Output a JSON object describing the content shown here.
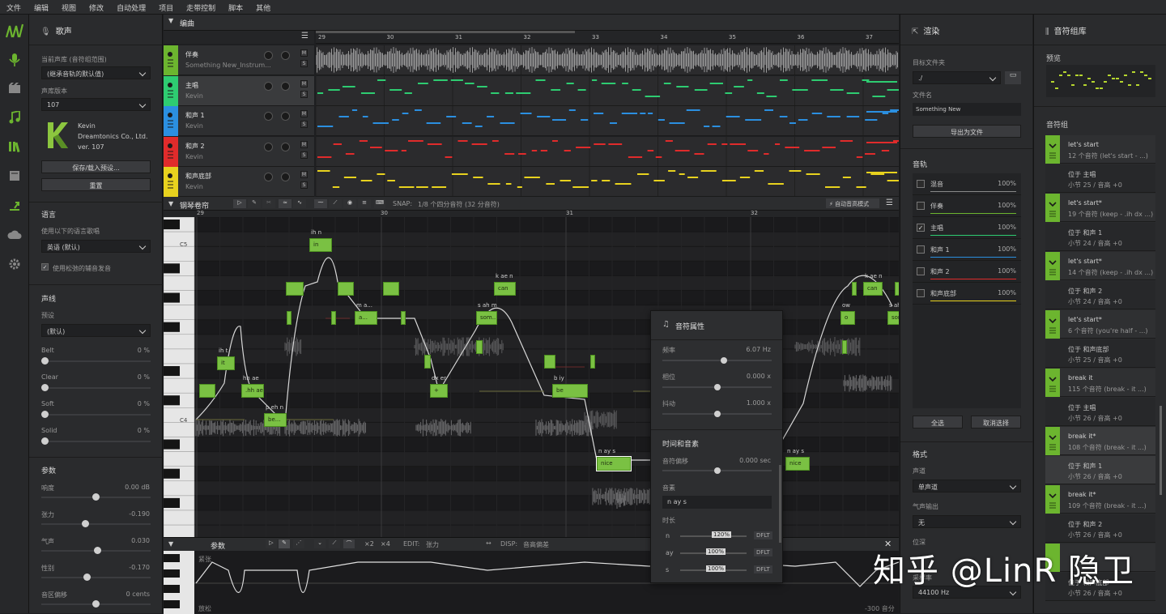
{
  "menu": [
    "文件",
    "编辑",
    "视图",
    "修改",
    "自动处理",
    "项目",
    "走带控制",
    "脚本",
    "其他"
  ],
  "voice": {
    "title": "歌声",
    "db_label": "当前声库 (音符组范围)",
    "db_value": "(继承音轨的默认值)",
    "version_label": "声库版本",
    "version_value": "107",
    "singer_name": "Kevin",
    "singer_company": "Dreamtonics Co., Ltd.",
    "singer_ver": "ver. 107",
    "save_btn": "保存/载入预设...",
    "reset_btn": "重置",
    "lang_header": "语言",
    "lang_label": "使用以下的语言歌唱",
    "lang_value": "英语 (默认)",
    "lang_check": "使用松弛的辅音发音",
    "timbre_header": "声线",
    "preset_label": "预设",
    "preset_value": "(默认)",
    "timbres": [
      {
        "name": "Belt",
        "val": "0 %"
      },
      {
        "name": "Clear",
        "val": "0 %"
      },
      {
        "name": "Soft",
        "val": "0 %"
      },
      {
        "name": "Solid",
        "val": "0 %"
      }
    ],
    "params_header": "参数",
    "params": [
      {
        "name": "响度",
        "val": "0.00 dB"
      },
      {
        "name": "张力",
        "val": "-0.190"
      },
      {
        "name": "气声",
        "val": "0.030"
      },
      {
        "name": "性别",
        "val": "-0.170"
      },
      {
        "name": "音区偏移",
        "val": "0 cents"
      }
    ]
  },
  "arrange": {
    "title": "编曲",
    "measures": [
      "29",
      "30",
      "31",
      "32",
      "33",
      "34",
      "35",
      "36",
      "37"
    ],
    "tracks": [
      {
        "name": "伴奏",
        "sub": "Something New_Instrum...",
        "color": "#6cb52f",
        "icon": "headphones-icon"
      },
      {
        "name": "主唱",
        "sub": "Kevin",
        "color": "#2ecc71",
        "icon": "singer-icon"
      },
      {
        "name": "和声 1",
        "sub": "Kevin",
        "color": "#2b8fe0",
        "icon": "singer-icon"
      },
      {
        "name": "和声 2",
        "sub": "Kevin",
        "color": "#e02b2b",
        "icon": "singer-icon"
      },
      {
        "name": "和声底部",
        "sub": "Kevin",
        "color": "#e8d21e",
        "icon": "singer-icon"
      }
    ],
    "m_label": "M",
    "s_label": "S"
  },
  "pianoroll": {
    "title": "钢琴卷帘",
    "snap_label": "SNAP:",
    "snap_value": "1/8 个四分音符 (32 分音符)",
    "auto_pitch": "自动音高模式",
    "measures": [
      "29",
      "30",
      "31",
      "32"
    ],
    "c5": "C5",
    "c4": "C4",
    "c3": "C3"
  },
  "params_bar": {
    "title": "参数",
    "edit_label": "EDIT:",
    "edit_value": "张力",
    "disp_label": "DISP:",
    "disp_value": "音高偏差",
    "x2": "×2",
    "x4": "×4",
    "top_label": "紧张",
    "bottom_label": "放松",
    "right_value": "-300 音分"
  },
  "note_panel": {
    "title": "音符属性",
    "freq_label": "频率",
    "freq_val": "6.07 Hz",
    "phase_label": "相位",
    "phase_val": "0.000 x",
    "jitter_label": "抖动",
    "jitter_val": "1.000 x",
    "timing_header": "时间和音素",
    "offset_label": "音符偏移",
    "offset_val": "0.000 sec",
    "phoneme_label": "音素",
    "phoneme_val": "n ay s",
    "duration_label": "时长",
    "durations": [
      {
        "ph": "n",
        "val": "120%",
        "btn": "DFLT"
      },
      {
        "ph": "ay",
        "val": "100%",
        "btn": "DFLT"
      },
      {
        "ph": "s",
        "val": "100%",
        "btn": "DFLT"
      }
    ]
  },
  "render": {
    "title": "渲染",
    "folder_label": "目标文件夹",
    "folder_value": "./",
    "file_label": "文件名",
    "file_value": "Something New",
    "export_btn": "导出为文件",
    "tracks_header": "音轨",
    "tracks": [
      {
        "name": "混音",
        "val": "100%",
        "checked": false,
        "color": "#888888"
      },
      {
        "name": "伴奏",
        "val": "100%",
        "checked": false,
        "color": "#6cb52f"
      },
      {
        "name": "主唱",
        "val": "100%",
        "checked": true,
        "color": "#2ecc71"
      },
      {
        "name": "和声 1",
        "val": "100%",
        "checked": false,
        "color": "#2b8fe0"
      },
      {
        "name": "和声 2",
        "val": "100%",
        "checked": false,
        "color": "#e02b2b"
      },
      {
        "name": "和声底部",
        "val": "100%",
        "checked": false,
        "color": "#e8d21e"
      }
    ],
    "select_all": "全选",
    "deselect": "取消选择",
    "format_header": "格式",
    "channel_label": "声道",
    "channel_value": "单声道",
    "breath_label": "气声输出",
    "breath_value": "无",
    "depth_label": "位深",
    "rate_label": "采样率",
    "rate_value": "44100 Hz",
    "check_mark": "✓"
  },
  "groups": {
    "title": "音符组库",
    "preview_label": "预览",
    "groups_header": "音符组",
    "items": [
      {
        "title": "let's start",
        "sub": "12 个音符 (let's start - ...)",
        "ref_t": "位于 主唱",
        "ref_s": "小节 25 / 音高 +0"
      },
      {
        "title": "let's start*",
        "sub": "19 个音符 (keep - .ih dx ...)",
        "ref_t": "位于 和声 1",
        "ref_s": "小节 24 / 音高 +0"
      },
      {
        "title": "let's start*",
        "sub": "14 个音符 (keep - .ih dx ...)",
        "ref_t": "位于 和声 2",
        "ref_s": "小节 24 / 音高 +0"
      },
      {
        "title": "let's start*",
        "sub": "6 个音符 (you're half - ...)",
        "ref_t": "位于 和声底部",
        "ref_s": "小节 25 / 音高 +0"
      },
      {
        "title": "break it",
        "sub": "115 个音符 (break - it ...)",
        "ref_t": "位于 主唱",
        "ref_s": "小节 26 / 音高 +0"
      },
      {
        "title": "break it*",
        "sub": "108 个音符 (break - it ...)",
        "ref_t": "位于 和声 1",
        "ref_s": "小节 26 / 音高 +0"
      },
      {
        "title": "break it*",
        "sub": "109 个音符 (break - it ...)",
        "ref_t": "位于 和声 2",
        "ref_s": "小节 26 / 音高 +0"
      },
      {
        "title": "",
        "sub": "",
        "ref_t": "位于 和声底部",
        "ref_s": "小节 26 / 音高 +0"
      }
    ]
  },
  "notes": [
    {
      "lyric": "it",
      "phon": "ih t"
    },
    {
      "lyric": ".hh ae",
      "phon": "hh ae"
    },
    {
      "lyric": "be...",
      "phon": "p eh n"
    },
    {
      "lyric": "in",
      "phon": "ih n"
    },
    {
      "lyric": "a...",
      "phon": "m a..."
    },
    {
      "lyric": "som...",
      "phon": "s ah m"
    },
    {
      "lyric": "can",
      "phon": "k ae n"
    },
    {
      "lyric": "+",
      "phon": "dx er"
    },
    {
      "lyric": "be",
      "phon": "b iy"
    },
    {
      "lyric": "nice",
      "phon": "n ay s"
    },
    {
      "lyric": "nice",
      "phon": "n ay s"
    },
    {
      "lyric": "can",
      "phon": "k ae n"
    },
    {
      "lyric": "o",
      "phon": "ow"
    },
    {
      "lyric": "som",
      "phon": "s ah"
    }
  ],
  "watermark": "知乎 @LinR 隐卫"
}
